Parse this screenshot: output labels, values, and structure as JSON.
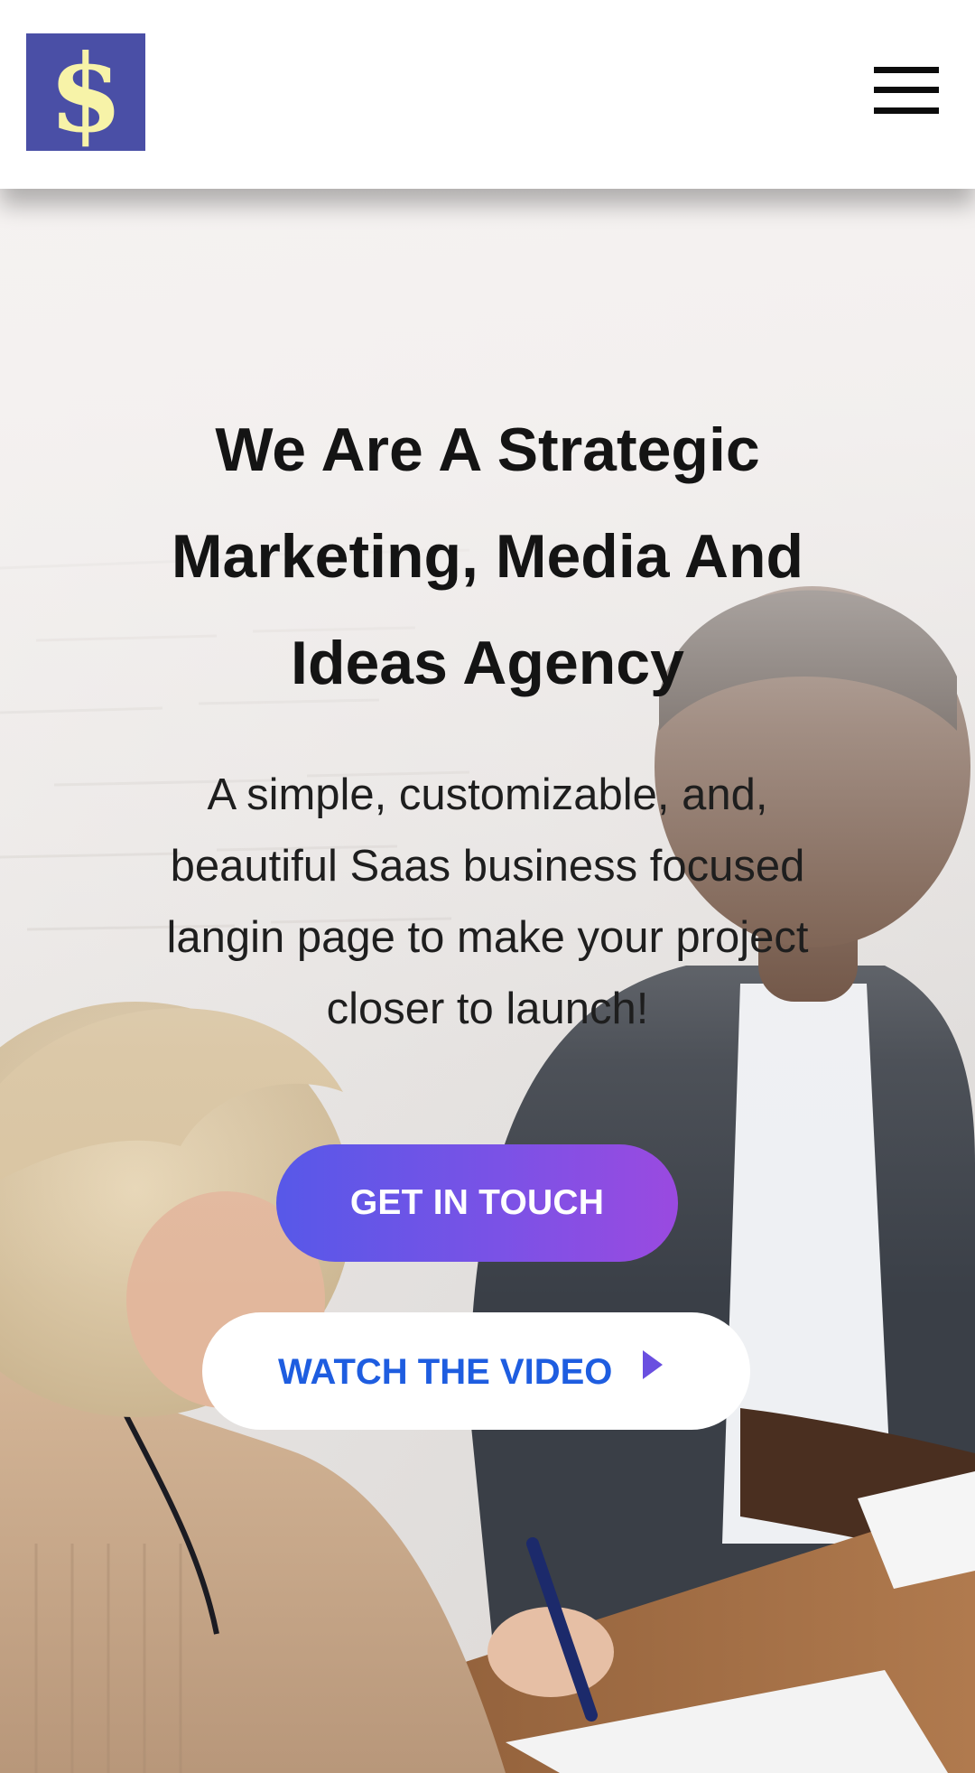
{
  "header": {
    "logo_symbol": "$",
    "logo_colors": {
      "background": "#4a4fa6",
      "glyph": "#f7f3a8"
    },
    "menu_icon": "hamburger-menu-icon"
  },
  "hero": {
    "title": "We Are A Strategic Marketing, Media And Ideas Agency",
    "subtitle": "A simple, customizable, and, beautiful Saas business focused langin page to make your project closer to launch!",
    "primary_button": {
      "label": "GET IN TOUCH",
      "gradient": [
        "#5758e8",
        "#9a4ae0"
      ]
    },
    "secondary_button": {
      "label": "WATCH THE VIDEO",
      "icon": "play-icon",
      "text_color": "#1e5de0",
      "icon_color": "#6a4fe0"
    }
  }
}
